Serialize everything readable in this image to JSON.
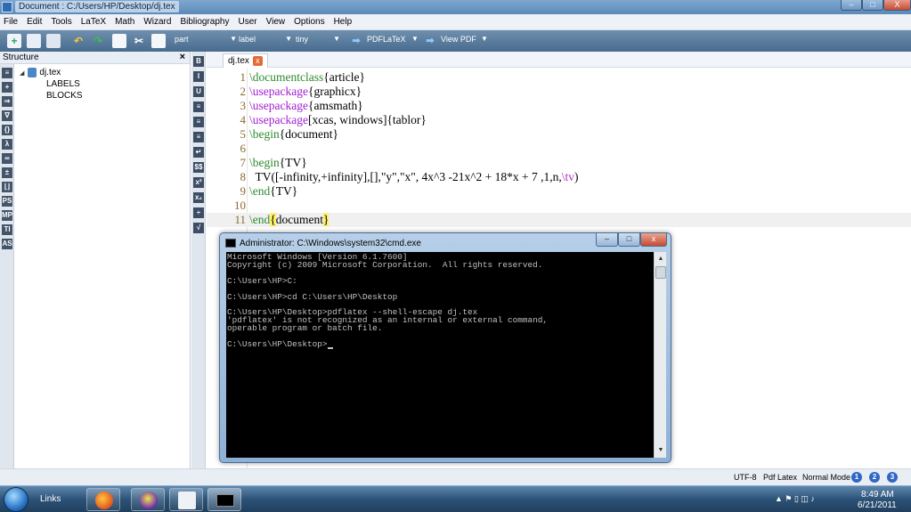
{
  "window": {
    "title": "Document : C:/Users/HP/Desktop/dj.tex",
    "min_label": "–",
    "max_label": "□",
    "close_label": "X"
  },
  "menu": [
    "File",
    "Edit",
    "Tools",
    "LaTeX",
    "Math",
    "Wizard",
    "Bibliography",
    "User",
    "View",
    "Options",
    "Help"
  ],
  "toolbar": {
    "combo_part": "part",
    "combo_label": "label",
    "combo_size": "tiny",
    "pdflatex": "PDFLaTeX",
    "viewpdf": "View PDF"
  },
  "structure": {
    "title": "Structure",
    "close": "×",
    "root": "dj.tex",
    "children": [
      "LABELS",
      "BLOCKS"
    ]
  },
  "left_strip_icons": [
    "≡",
    "+",
    "⇒",
    "∇",
    "{}",
    "λ",
    "∞",
    "±",
    "⌊⌋",
    "PS",
    "MP",
    "TI",
    "AS"
  ],
  "symbol_strip_icons": [
    "B",
    "I",
    "U",
    "≡",
    "≡",
    "≡",
    "↵",
    "$$",
    "x²",
    "x₂",
    "÷",
    "√"
  ],
  "tab": {
    "label": "dj.tex",
    "close": "x"
  },
  "editor": {
    "lines": [
      {
        "num": "1",
        "parts": [
          [
            "\\documentclass",
            "green"
          ],
          [
            "{article}",
            "plain"
          ]
        ]
      },
      {
        "num": "2",
        "parts": [
          [
            "\\usepackage",
            "purple"
          ],
          [
            "{graphicx}",
            "plain"
          ]
        ]
      },
      {
        "num": "3",
        "parts": [
          [
            "\\usepackage",
            "purple"
          ],
          [
            "{amsmath}",
            "plain"
          ]
        ]
      },
      {
        "num": "4",
        "parts": [
          [
            "\\usepackage",
            "purple"
          ],
          [
            "[xcas, windows]{tablor}",
            "plain"
          ]
        ]
      },
      {
        "num": "5",
        "parts": [
          [
            "\\begin",
            "green"
          ],
          [
            "{document}",
            "plain"
          ]
        ]
      },
      {
        "num": "6",
        "parts": []
      },
      {
        "num": "7",
        "parts": [
          [
            "\\begin",
            "green"
          ],
          [
            "{TV}",
            "plain"
          ]
        ]
      },
      {
        "num": "8",
        "parts": [
          [
            "  TV([-infinity,+infinity],[],\"y\",\"x\", 4x^3 -21x^2 + 18*x + 7 ,1,n,",
            "plain"
          ],
          [
            "\\tv",
            "magenta"
          ],
          [
            ")",
            "plain"
          ]
        ]
      },
      {
        "num": "9",
        "parts": [
          [
            "\\end",
            "green"
          ],
          [
            "{TV}",
            "plain"
          ]
        ]
      },
      {
        "num": "10",
        "parts": []
      },
      {
        "num": "11",
        "parts": [
          [
            "\\end",
            "green"
          ],
          [
            "{",
            "hl"
          ],
          [
            "document",
            "plain"
          ],
          [
            "}",
            "hl"
          ]
        ]
      }
    ]
  },
  "cmd": {
    "title": "Administrator: C:\\Windows\\system32\\cmd.exe",
    "min": "–",
    "max": "□",
    "close": "x",
    "console_lines": [
      "Microsoft Windows [Version 6.1.7600]",
      "Copyright (c) 2009 Microsoft Corporation.  All rights reserved.",
      "",
      "C:\\Users\\HP>C:",
      "",
      "C:\\Users\\HP>cd C:\\Users\\HP\\Desktop",
      "",
      "C:\\Users\\HP\\Desktop>pdflatex --shell-escape dj.tex",
      "'pdflatex' is not recognized as an internal or external command,",
      "operable program or batch file.",
      "",
      "C:\\Users\\HP\\Desktop>"
    ]
  },
  "status": {
    "encoding": "UTF-8",
    "compiler": "Pdf Latex",
    "mode": "Normal Mode",
    "buttons": [
      "1",
      "2",
      "3"
    ]
  },
  "taskbar": {
    "links": "Links",
    "time": "8:49 AM",
    "date": "6/21/2011"
  }
}
